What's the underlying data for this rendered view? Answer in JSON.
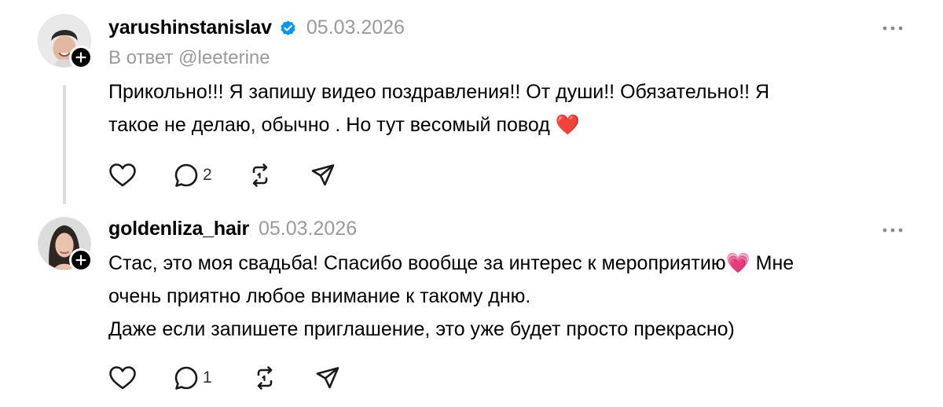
{
  "posts": [
    {
      "username": "yarushinstanislav",
      "verified": true,
      "date": "05.03.2026",
      "reply_to": "В ответ @leeterine",
      "text_lines": [
        "Прикольно!!! Я запишу видео поздравления!! От души!! Обязательно!! Я",
        "такое не делаю, обычно . Но тут весомый повод ❤️"
      ],
      "reply_count": "2",
      "icons": [
        "heart-icon",
        "comment-icon",
        "repost-icon",
        "share-icon",
        "more-icon",
        "verified-icon",
        "plus-icon"
      ]
    },
    {
      "username": "goldenliza_hair",
      "verified": false,
      "date": "05.03.2026",
      "text_lines": [
        "Стас, это моя свадьба! Спасибо вообще за интерес к мероприятию💗 Мне",
        "очень приятно любое внимание к такому дню.",
        "Даже если запишете приглашение, это уже будет просто прекрасно)"
      ],
      "reply_count": "1",
      "icons": [
        "heart-icon",
        "comment-icon",
        "repost-icon",
        "share-icon",
        "more-icon",
        "plus-icon"
      ]
    }
  ],
  "colors": {
    "text": "#000000",
    "muted": "#9a9a9a",
    "verified": "#0095f6",
    "thread_line": "#dcdcdc"
  }
}
